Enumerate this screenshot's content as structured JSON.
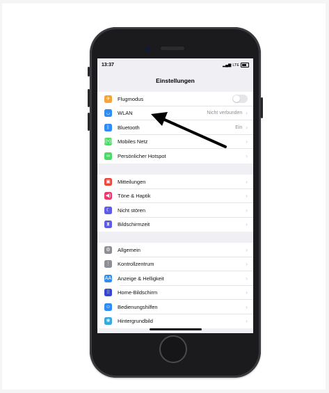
{
  "status": {
    "time": "13:37",
    "network": "LTE"
  },
  "title": "Einstellungen",
  "groups": [
    {
      "items": [
        {
          "label": "Flugmodus",
          "icon": "airplane-icon",
          "color": "#f7a33b",
          "glyph": "✈",
          "toggle": true
        },
        {
          "label": "WLAN",
          "icon": "wifi-icon",
          "color": "#2f8cf4",
          "glyph": "◡",
          "value": "Nicht verbunden"
        },
        {
          "label": "Bluetooth",
          "icon": "bluetooth-icon",
          "color": "#2f8cf4",
          "glyph": "ᛒ",
          "value": "Ein"
        },
        {
          "label": "Mobiles Netz",
          "icon": "antenna-icon",
          "color": "#4cd964",
          "glyph": "((•))"
        },
        {
          "label": "Persönlicher Hotspot",
          "icon": "hotspot-icon",
          "color": "#4cd964",
          "glyph": "∞"
        }
      ]
    },
    {
      "items": [
        {
          "label": "Mitteilungen",
          "icon": "notifications-icon",
          "color": "#f0443a",
          "glyph": "▣"
        },
        {
          "label": "Töne & Haptik",
          "icon": "speaker-icon",
          "color": "#f0366b",
          "glyph": "◀)"
        },
        {
          "label": "Nicht stören",
          "icon": "moon-icon",
          "color": "#5e5ce6",
          "glyph": "☾"
        },
        {
          "label": "Bildschirmzeit",
          "icon": "hourglass-icon",
          "color": "#5e5ce6",
          "glyph": "⧗"
        }
      ]
    },
    {
      "items": [
        {
          "label": "Allgemein",
          "icon": "gear-icon",
          "color": "#8e8e93",
          "glyph": "⚙"
        },
        {
          "label": "Kontrollzentrum",
          "icon": "switches-icon",
          "color": "#8e8e93",
          "glyph": "⋮"
        },
        {
          "label": "Anzeige & Helligkeit",
          "icon": "display-icon",
          "color": "#2f8cf4",
          "glyph": "AA"
        },
        {
          "label": "Home-Bildschirm",
          "icon": "homescreen-icon",
          "color": "#3346d6",
          "glyph": "⁞⁞"
        },
        {
          "label": "Bedienungshilfen",
          "icon": "accessibility-icon",
          "color": "#2f8cf4",
          "glyph": "☺"
        },
        {
          "label": "Hintergrundbild",
          "icon": "wallpaper-icon",
          "color": "#35aadc",
          "glyph": "❀"
        }
      ]
    }
  ]
}
